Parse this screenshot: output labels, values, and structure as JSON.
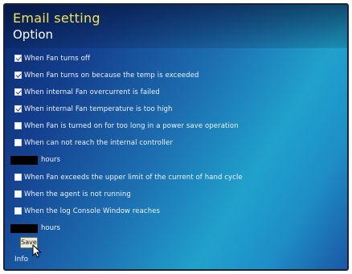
{
  "window": {
    "title": "Email setting",
    "subtitle": "Option"
  },
  "options": [
    {
      "label": "When Fan turns off",
      "checked": true
    },
    {
      "label": "When Fan turns on because the temp is exceeded",
      "checked": true
    },
    {
      "label": "When internal Fan overcurrent is failed",
      "checked": true
    },
    {
      "label": "When internal Fan temperature is too high",
      "checked": true
    },
    {
      "label": "When Fan is turned on for too long in a power save operation",
      "checked": false
    },
    {
      "label": "When can not reach the internal controller",
      "checked": false
    }
  ],
  "interval_1": {
    "value": "",
    "unit": "hours"
  },
  "options_2": [
    {
      "label": "When Fan exceeds the upper limit of the current of hand cycle",
      "checked": false
    },
    {
      "label": "When the agent is not running",
      "checked": false
    },
    {
      "label": "When the log Console Window reaches",
      "checked": false
    }
  ],
  "interval_2": {
    "value": "",
    "unit": "hours"
  },
  "save_button": {
    "label": "Save"
  },
  "status": {
    "text": "Info"
  },
  "colors": {
    "title": "#f2e35a",
    "background_start": "#0b2a6e",
    "background_end": "#20a2cc"
  }
}
